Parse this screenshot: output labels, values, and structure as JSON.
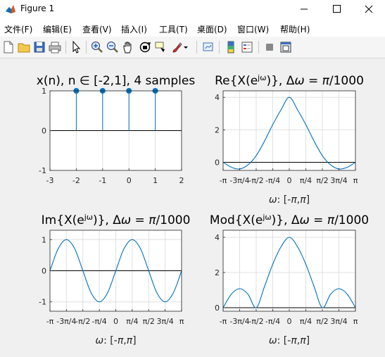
{
  "window": {
    "title": "Figure 1"
  },
  "menu": [
    "文件(F)",
    "编辑(E)",
    "查看(V)",
    "插入(I)",
    "工具(T)",
    "桌面(D)",
    "窗口(W)",
    "帮助(H)"
  ],
  "toolbar": [
    "new-file-icon",
    "open-folder-icon",
    "save-icon",
    "print-icon",
    "pointer-icon",
    "zoom-in-icon",
    "zoom-out-icon",
    "pan-hand-icon",
    "rotate-3d-icon",
    "data-cursor-icon",
    "brush-icon",
    "brush-dropdown-icon",
    "link-plot-icon",
    "colorbar-icon",
    "legend-icon",
    "hide-plot-tools-icon",
    "show-plot-tools-icon"
  ],
  "chart_data": [
    {
      "type": "stem",
      "title": "x(n), n ∈ [-2,1], 4 samples",
      "x": [
        -2,
        -1,
        0,
        1
      ],
      "values": [
        1,
        1,
        1,
        1
      ],
      "xlim": [
        -3,
        2
      ],
      "ylim": [
        -1,
        1
      ],
      "xticks": [
        "-3",
        "-2",
        "-1",
        "0",
        "1",
        "2"
      ],
      "yticks": [
        "-1",
        "0",
        "1"
      ],
      "xlabel": "",
      "ylabel": "",
      "grid": true
    },
    {
      "type": "line",
      "title": "Re{X(e^jω)}, Δω = π/1000",
      "series": [
        {
          "x": [
            -3.1416,
            -2.7489,
            -2.3562,
            -1.9635,
            -1.5708,
            -1.1781,
            -0.7854,
            -0.3927,
            0,
            0.3927,
            0.7854,
            1.1781,
            1.5708,
            1.9635,
            2.3562,
            2.7489,
            3.1416
          ],
          "values": [
            0,
            -0.31,
            -0.41,
            -0.16,
            0.41,
            1.3,
            2.32,
            3.23,
            4,
            3.23,
            2.32,
            1.3,
            0.41,
            -0.16,
            -0.41,
            -0.31,
            0
          ]
        }
      ],
      "xlim": [
        -3.1416,
        3.1416
      ],
      "ylim": [
        -0.5,
        4.4
      ],
      "xticks": [
        "-π",
        "-3π/4",
        "-π/2",
        "-π/4",
        "0",
        "π/4",
        "π/2",
        "3π/4",
        "π"
      ],
      "yticks": [
        "0",
        "2",
        "4"
      ],
      "xlabel": "ω: [-π,π]",
      "ylabel": "",
      "grid": true
    },
    {
      "type": "line",
      "title": "Im{X(e^jω)}, Δω = π/1000",
      "series": [
        {
          "x": [
            -3.1416,
            -2.7489,
            -2.3562,
            -1.9635,
            -1.5708,
            -1.1781,
            -0.7854,
            -0.3927,
            0,
            0.3927,
            0.7854,
            1.1781,
            1.5708,
            1.9635,
            2.3562,
            2.7489,
            3.1416
          ],
          "values": [
            0,
            0.71,
            1,
            0.71,
            0,
            -0.71,
            -1,
            -0.71,
            0,
            0.71,
            1,
            0.71,
            0,
            -0.71,
            -1,
            -0.71,
            0
          ]
        }
      ],
      "xlim": [
        -3.1416,
        3.1416
      ],
      "ylim": [
        -1.3,
        1.3
      ],
      "xticks": [
        "-π",
        "-3π/4",
        "-π/2",
        "-π/4",
        "0",
        "π/4",
        "π/2",
        "3π/4",
        "π"
      ],
      "yticks": [
        "-1",
        "0",
        "1"
      ],
      "xlabel": "ω: [-π,π]",
      "ylabel": "",
      "grid": true
    },
    {
      "type": "line",
      "title": "Mod{X(e^jω)}, Δω = π/1000",
      "series": [
        {
          "x": [
            -3.1416,
            -2.7489,
            -2.3562,
            -1.9635,
            -1.5708,
            -1.1781,
            -0.7854,
            -0.3927,
            0,
            0.3927,
            0.7854,
            1.1781,
            1.5708,
            1.9635,
            2.3562,
            2.7489,
            3.1416
          ],
          "values": [
            0,
            0.77,
            1.08,
            0.77,
            0,
            1.2,
            2.47,
            3.46,
            4,
            3.46,
            2.47,
            1.2,
            0,
            0.77,
            1.08,
            0.77,
            0
          ]
        }
      ],
      "xlim": [
        -3.1416,
        3.1416
      ],
      "ylim": [
        -0.2,
        4.4
      ],
      "xticks": [
        "-π",
        "-3π/4",
        "-π/2",
        "-π/4",
        "0",
        "π/4",
        "π/2",
        "3π/4",
        "π"
      ],
      "yticks": [
        "0",
        "2",
        "4"
      ],
      "xlabel": "ω: [-π,π]",
      "ylabel": "",
      "grid": true
    }
  ],
  "colors": {
    "series": "#0072bd",
    "axis_zero": "#000000",
    "grid": "#e0e0e0"
  }
}
